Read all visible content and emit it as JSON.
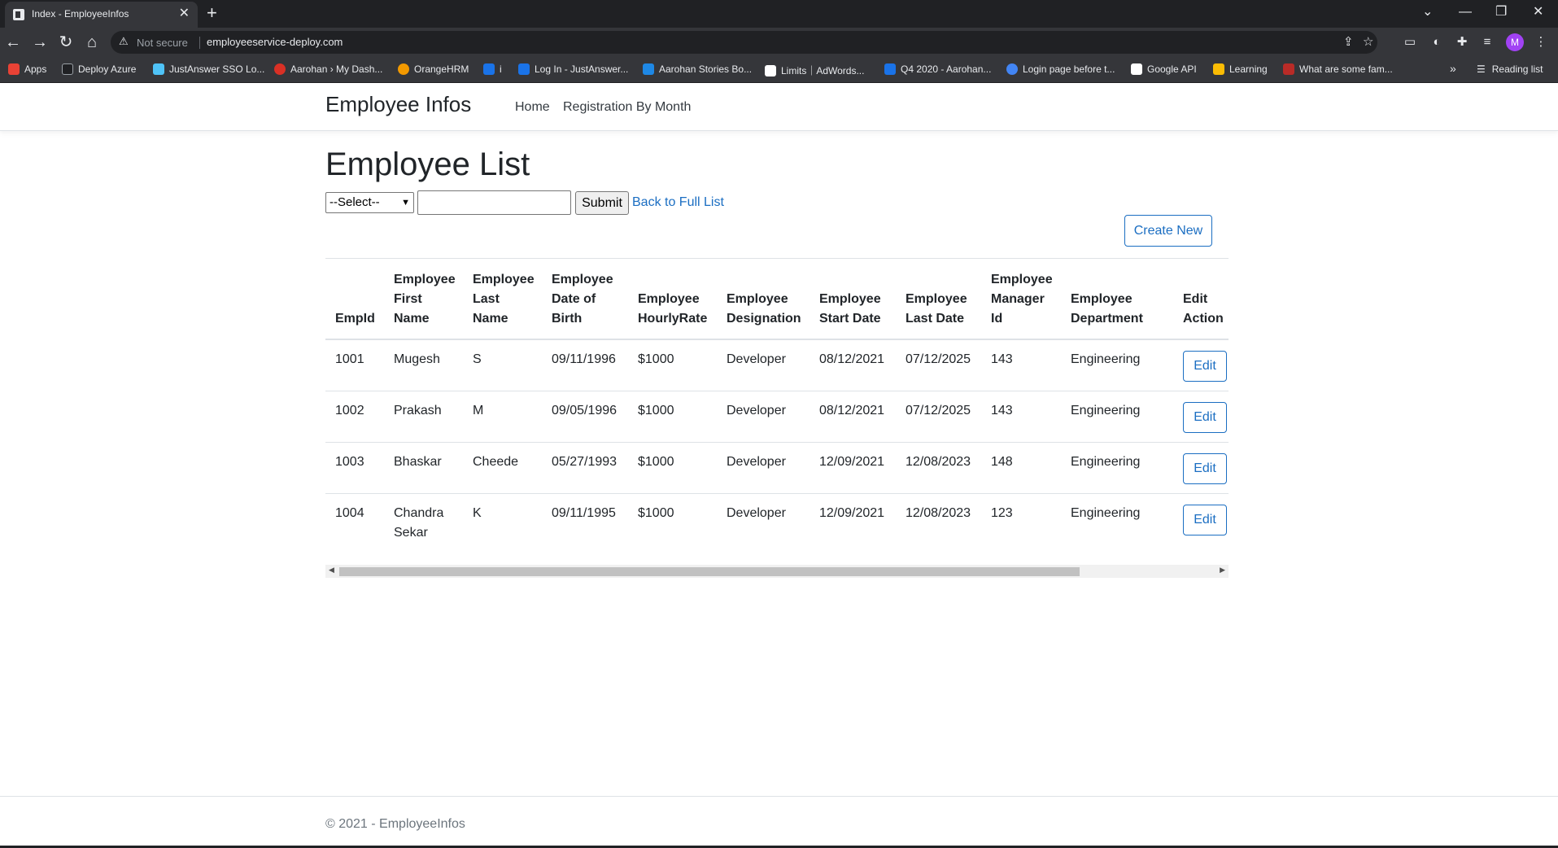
{
  "browser": {
    "tab_title": "Index - EmployeeInfos",
    "tab_close": "✕",
    "new_tab": "+",
    "not_secure": "Not secure",
    "url": "employeeservice-deploy.com",
    "profile_initial": "M",
    "bookmarks": [
      {
        "label": "Apps",
        "color": "#e94235"
      },
      {
        "label": "Deploy Azure",
        "color": "#202124"
      },
      {
        "label": "JustAnswer SSO Lo...",
        "color": "#4fc3f7"
      },
      {
        "label": "Aarohan › My Dash...",
        "color": "#d93025"
      },
      {
        "label": "OrangeHRM",
        "color": "#f29900"
      },
      {
        "label": "i",
        "color": "#1a73e8"
      },
      {
        "label": "Log In - JustAnswer...",
        "color": "#1a73e8"
      },
      {
        "label": "Aarohan Stories Bo...",
        "color": "#1e88e5"
      },
      {
        "label": "Limits｜AdWords...",
        "color": "#ffffff"
      },
      {
        "label": "Q4 2020 - Aarohan...",
        "color": "#1a73e8"
      },
      {
        "label": "Login page before t...",
        "color": "#4285f4"
      },
      {
        "label": "Google API",
        "color": "#ffffff"
      },
      {
        "label": "Learning",
        "color": "#fbbc04"
      },
      {
        "label": "What are some fam...",
        "color": "#b92b27"
      }
    ],
    "bookmarks_more": "»",
    "reading_list": "Reading list"
  },
  "nav": {
    "brand": "Employee Infos",
    "links": [
      "Home",
      "Registration By Month"
    ]
  },
  "main": {
    "title": "Employee List",
    "select_value": "--Select--",
    "submit_label": "Submit",
    "back_link": "Back to Full List",
    "create_label": "Create New"
  },
  "table": {
    "headers": [
      [
        "EmpId"
      ],
      [
        "Employee",
        "First",
        "Name"
      ],
      [
        "Employee",
        "Last",
        "Name"
      ],
      [
        "Employee",
        "Date of",
        "Birth"
      ],
      [
        "Employee",
        "HourlyRate"
      ],
      [
        "Employee",
        "Designation"
      ],
      [
        "Employee",
        "Start Date"
      ],
      [
        "Employee",
        "Last Date"
      ],
      [
        "Employee",
        "Manager",
        "Id"
      ],
      [
        "Employee",
        "Department"
      ],
      [
        "Edit",
        "Action"
      ]
    ],
    "rows": [
      {
        "id": "1001",
        "first": "Mugesh",
        "first2": "",
        "last": "S",
        "dob": "09/11/1996",
        "rate": "$1000",
        "designation": "Developer",
        "start": "08/12/2021",
        "end": "07/12/2025",
        "manager": "143",
        "department": "Engineering",
        "edit": "Edit"
      },
      {
        "id": "1002",
        "first": "Prakash",
        "first2": "",
        "last": "M",
        "dob": "09/05/1996",
        "rate": "$1000",
        "designation": "Developer",
        "start": "08/12/2021",
        "end": "07/12/2025",
        "manager": "143",
        "department": "Engineering",
        "edit": "Edit"
      },
      {
        "id": "1003",
        "first": "Bhaskar",
        "first2": "",
        "last": "Cheede",
        "dob": "05/27/1993",
        "rate": "$1000",
        "designation": "Developer",
        "start": "12/09/2021",
        "end": "12/08/2023",
        "manager": "148",
        "department": "Engineering",
        "edit": "Edit"
      },
      {
        "id": "1004",
        "first": "Chandra",
        "first2": "Sekar",
        "last": "K",
        "dob": "09/11/1995",
        "rate": "$1000",
        "designation": "Developer",
        "start": "12/09/2021",
        "end": "12/08/2023",
        "manager": "123",
        "department": "Engineering",
        "edit": "Edit"
      }
    ]
  },
  "footer": {
    "text": "© 2021 - EmployeeInfos"
  },
  "colors": {
    "link": "#1b6ec2",
    "chrome_dark": "#202124",
    "chrome_toolbar": "#35363a"
  }
}
